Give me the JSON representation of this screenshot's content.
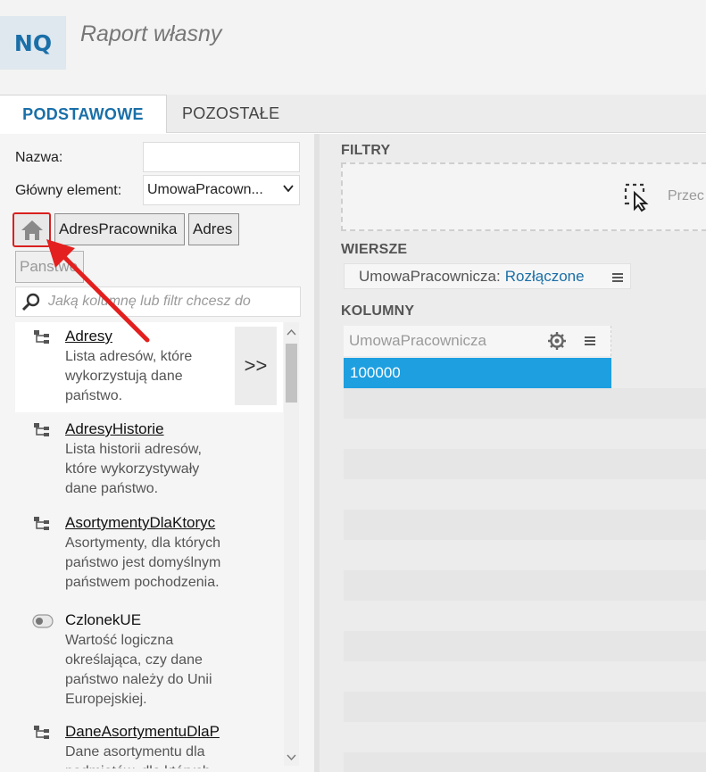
{
  "header": {
    "logo": "NQ",
    "title": "Raport własny"
  },
  "tabs": [
    {
      "label": "PODSTAWOWE",
      "active": true
    },
    {
      "label": "POZOSTAŁE",
      "active": false
    }
  ],
  "form": {
    "name_label": "Nazwa:",
    "name_value": "",
    "main_label": "Główny element:",
    "main_value": "UmowaPracown..."
  },
  "breadcrumb": {
    "items": [
      "AdresPracownika",
      "Adres"
    ],
    "current": "Panstwo"
  },
  "search": {
    "placeholder": "Jaką kolumnę lub filtr chcesz do"
  },
  "list": {
    "expand_label": ">>",
    "items": [
      {
        "name": "Adresy",
        "desc": "Lista adresów, które wykorzystują dane państwo.",
        "icon": "hierarchy-icon"
      },
      {
        "name": "AdresyHistorie",
        "desc": "Lista historii adresów, które wykorzystywały dane państwo.",
        "icon": "hierarchy-icon"
      },
      {
        "name": "AsortymentyDlaKtoryc",
        "desc": "Asortymenty, dla których państwo jest domyślnym państwem pochodzenia.",
        "icon": "hierarchy-icon"
      },
      {
        "name": "CzlonekUE",
        "desc": "Wartość logiczna określająca, czy dane państwo należy do Unii Europejskiej.",
        "icon": "toggle-icon"
      },
      {
        "name": "DaneAsortymentuDlaP",
        "desc": "Dane asortymentu dla podmiotów, dla których",
        "icon": "hierarchy-icon"
      }
    ]
  },
  "right": {
    "filters_label": "FILTRY",
    "filters_drop_text": "Przec",
    "rows_label": "WIERSZE",
    "row_chip_key": "UmowaPracownicza:",
    "row_chip_value": "Rozłączone",
    "columns_label": "KOLUMNY",
    "column_header": "UmowaPracownicza",
    "cell_value": "100000"
  },
  "colors": {
    "accent": "#1a6fa8",
    "selection": "#1d9fe0",
    "highlight": "#d9201f"
  }
}
